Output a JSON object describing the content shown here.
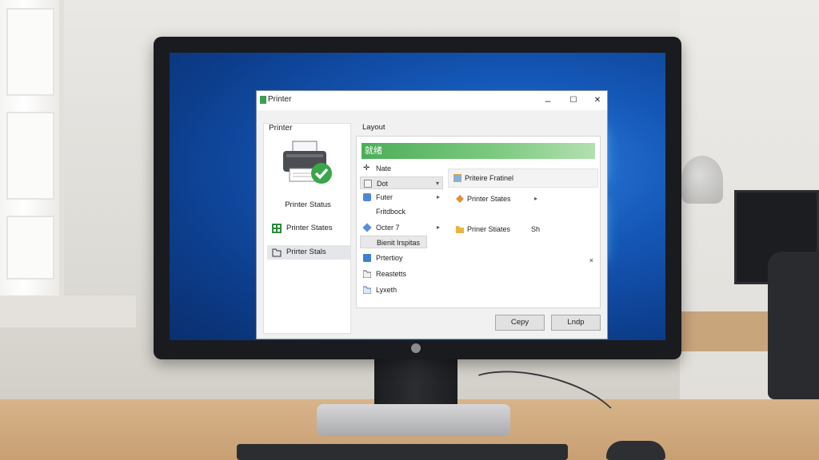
{
  "dialog": {
    "title": "Printer",
    "controls": {
      "minimize": "–",
      "maximize": "☐",
      "close": "✕"
    }
  },
  "left_panel": {
    "header": "Printer",
    "status_caption": "Printer Status",
    "items": [
      {
        "label": "Printer States",
        "icon": "grid-icon"
      },
      {
        "label": "Prirter Stals",
        "icon": "folder-icon"
      }
    ]
  },
  "right_panel": {
    "layout_label": "Layout",
    "status_text": "就绪",
    "menu": [
      {
        "label": "Nate",
        "icon": "plus-icon",
        "arrow": ""
      },
      {
        "label": "Dot",
        "icon": "box-icon",
        "arrow": "▾"
      },
      {
        "label": "Futer",
        "icon": "puzzle-icon",
        "arrow": "▸"
      },
      {
        "label": "Fritdbock",
        "icon": "",
        "arrow": ""
      },
      {
        "label": "Octer 7",
        "icon": "cube-icon",
        "arrow": "▸"
      },
      {
        "label": "Bienit Irspitas",
        "icon": "",
        "arrow": ""
      },
      {
        "label": "Prtertioy",
        "icon": "monitor-icon",
        "arrow": ""
      },
      {
        "label": "Reastetts",
        "icon": "folder-icon",
        "arrow": ""
      },
      {
        "label": "Lyxeth",
        "icon": "folder-icon",
        "arrow": ""
      }
    ],
    "submenu": [
      {
        "label": "Priteire Fratinel",
        "icon": "image-icon"
      },
      {
        "label": "Printer States",
        "icon": "wrench-icon",
        "arrow": "▸"
      },
      {
        "label": "Priner Stiates",
        "icon": "folder-icon",
        "extra": "Sh"
      }
    ],
    "close_glyph": "×"
  },
  "buttons": {
    "copy": "Cepy",
    "apply": "Lndp"
  }
}
